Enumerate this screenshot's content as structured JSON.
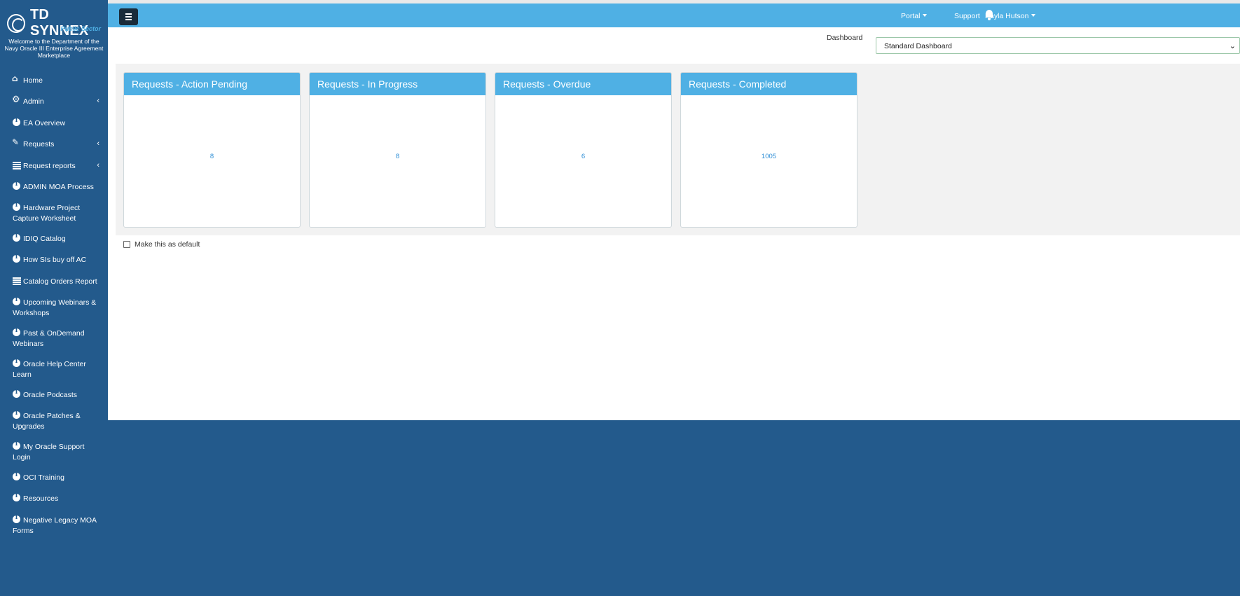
{
  "brand": {
    "name": "TD SYNNEX",
    "tagline": "Public Sector",
    "welcome": "Welcome to the Department of the Navy Oracle III Enterprise Agreement Marketplace"
  },
  "sidebar": {
    "items": [
      {
        "label": "Home",
        "icon": "home-icon",
        "submenu": false
      },
      {
        "label": "Admin",
        "icon": "gear-icon",
        "submenu": true
      },
      {
        "label": "EA Overview",
        "icon": "info-icon",
        "submenu": false
      },
      {
        "label": "Requests",
        "icon": "edit-icon",
        "submenu": true
      },
      {
        "label": "Request reports",
        "icon": "list-icon",
        "submenu": true
      },
      {
        "label": "ADMIN MOA Process",
        "icon": "info-icon",
        "submenu": false
      },
      {
        "label": "Hardware Project Capture Worksheet",
        "icon": "info-icon",
        "submenu": false
      },
      {
        "label": "IDIQ Catalog",
        "icon": "info-icon",
        "submenu": false
      },
      {
        "label": "How SIs buy off AC",
        "icon": "info-icon",
        "submenu": false
      },
      {
        "label": "Catalog Orders Report",
        "icon": "list-icon",
        "submenu": false
      },
      {
        "label": "Upcoming Webinars & Workshops",
        "icon": "info-icon",
        "submenu": false
      },
      {
        "label": "Past & OnDemand Webinars",
        "icon": "info-icon",
        "submenu": false
      },
      {
        "label": "Oracle Help Center Learn",
        "icon": "info-icon",
        "submenu": false
      },
      {
        "label": "Oracle Podcasts",
        "icon": "info-icon",
        "submenu": false
      },
      {
        "label": "Oracle Patches & Upgrades",
        "icon": "info-icon",
        "submenu": false
      },
      {
        "label": "My Oracle Support Login",
        "icon": "info-icon",
        "submenu": false
      },
      {
        "label": "OCI Training",
        "icon": "info-icon",
        "submenu": false
      },
      {
        "label": "Resources",
        "icon": "info-icon",
        "submenu": false
      },
      {
        "label": "Negative Legacy MOA Forms",
        "icon": "info-icon",
        "submenu": false
      }
    ],
    "chevron": "‹"
  },
  "topbar": {
    "portal": "Portal",
    "support": "Support",
    "user": "Kayla Hutson"
  },
  "dashboard": {
    "label": "Dashboard",
    "selected": "Standard Dashboard",
    "select_caret": "⌄",
    "cards": [
      {
        "title": "Requests - Action Pending",
        "count": "8"
      },
      {
        "title": "Requests - In Progress",
        "count": "8"
      },
      {
        "title": "Requests - Overdue",
        "count": "6"
      },
      {
        "title": "Requests - Completed",
        "count": "1005"
      }
    ],
    "default_label": "Make this as default"
  },
  "colors": {
    "sidebar": "#235a8c",
    "topbar": "#4fb0e4",
    "card_header": "#4fb0e4",
    "count_text": "#2d8ed6"
  }
}
